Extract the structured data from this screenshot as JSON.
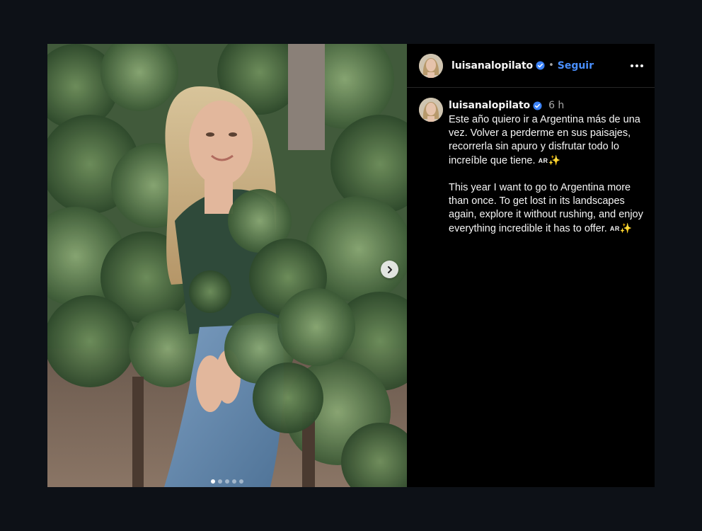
{
  "colors": {
    "background": "#0d1117",
    "panel": "#000000",
    "follow_link": "#4a90ff",
    "verified_badge": "#3b82f6",
    "muted_text": "#a8a8a8"
  },
  "media": {
    "next_icon": "chevron-right-icon",
    "carousel": {
      "total": 5,
      "active_index": 0
    }
  },
  "header": {
    "username": "luisanalopilato",
    "separator": "•",
    "follow_label": "Seguir",
    "more_icon": "more-horizontal-icon"
  },
  "comment": {
    "username": "luisanalopilato",
    "time": "6 h",
    "paragraph1": "Este año quiero ir a Argentina más de una vez. Volver a perderme en sus paisajes, recorrerla sin apuro y disfrutar todo lo increíble que tiene. ",
    "paragraph2": "This year I want to go to Argentina more than once. To get lost in its landscapes again, explore it without rushing, and enjoy everything incredible it has to offer. ",
    "flag_text": "AR",
    "sparkle": "✨"
  }
}
